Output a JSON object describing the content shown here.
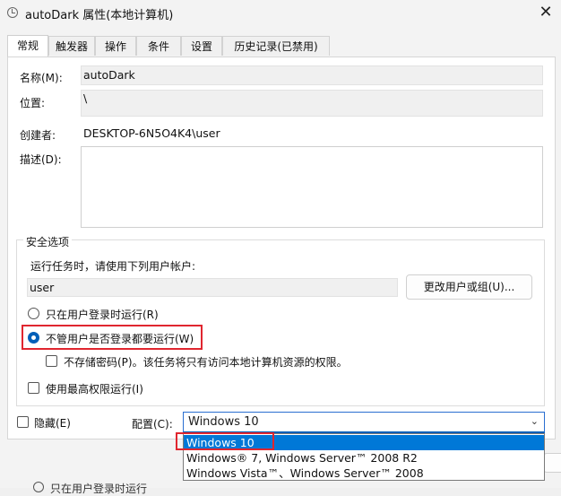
{
  "window": {
    "title": "autoDark 属性(本地计算机)",
    "close_glyph": "✕"
  },
  "tabs": [
    {
      "label": "常规",
      "active": true
    },
    {
      "label": "触发器",
      "active": false
    },
    {
      "label": "操作",
      "active": false
    },
    {
      "label": "条件",
      "active": false
    },
    {
      "label": "设置",
      "active": false
    },
    {
      "label": "历史记录(已禁用)",
      "active": false
    }
  ],
  "general": {
    "name_label": "名称(M):",
    "name_value": "autoDark",
    "location_label": "位置:",
    "location_value": "\\",
    "author_label": "创建者:",
    "author_value": "DESKTOP-6N5O4K4\\user",
    "description_label": "描述(D):",
    "description_value": ""
  },
  "security": {
    "group_title": "安全选项",
    "run_as_prompt": "运行任务时，请使用下列用户帐户:",
    "user_value": "user",
    "change_user_button": "更改用户或组(U)...",
    "radio_logged_on": "只在用户登录时运行(R)",
    "radio_whether_logged": "不管用户是否登录都要运行(W)",
    "check_no_store_pwd": "不存储密码(P)。该任务将只有访问本地计算机资源的权限。",
    "check_highest": "使用最高权限运行(I)"
  },
  "bottom": {
    "hidden_label": "隐藏(E)",
    "config_label": "配置(C):",
    "config_value": "Windows 10",
    "config_options": [
      "Windows 10",
      "Windows® 7, Windows Server™ 2008 R2",
      "Windows Vista™、Windows Server™ 2008"
    ],
    "truncated_text": "只在用户登录时运行"
  },
  "colors": {
    "accent": "#005fb8",
    "highlight_red": "#e0262f",
    "selected_option": "#0078d7"
  }
}
